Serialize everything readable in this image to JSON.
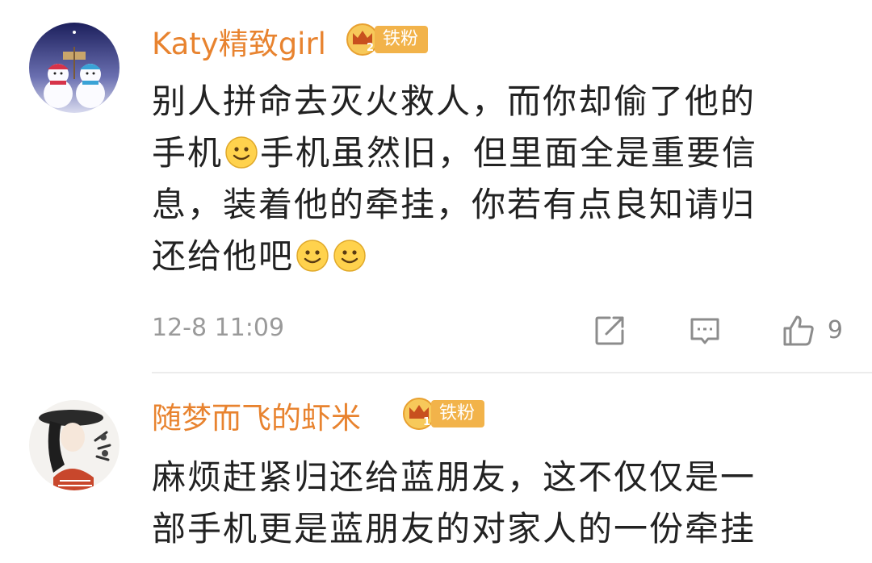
{
  "comments": [
    {
      "username": "Katy精致girl",
      "badge": {
        "level": "2",
        "label": "铁粉"
      },
      "body_lines": [
        [
          "别人拼命去灭火救人，而你却偷了他的"
        ],
        [
          "手机",
          "smile",
          "手机虽然旧，但里面全是重要信"
        ],
        [
          "息，装着他的牵挂，你若有点良知请归"
        ],
        [
          "还给他吧",
          "smile",
          "smile"
        ]
      ],
      "timestamp": "12-8 11:09",
      "like_count": "9"
    },
    {
      "username": "随梦而飞的虾米",
      "badge": {
        "level": "1",
        "label": "铁粉"
      },
      "body_lines": [
        [
          "麻烦赶紧归还给蓝朋友，这不仅仅是一"
        ],
        [
          "部手机更是蓝朋友的对家人的一份牵挂"
        ]
      ]
    }
  ],
  "icons": {
    "share": "share-icon",
    "reply": "comment-icon",
    "like": "thumbs-up-icon",
    "emoji": "smile-emoji-icon",
    "badge": "crown-icon"
  },
  "colors": {
    "username": "#e8832f",
    "badge_bg": "#f2b34a",
    "text": "#222222",
    "meta": "#9a9a9a",
    "divider": "#ececec"
  }
}
